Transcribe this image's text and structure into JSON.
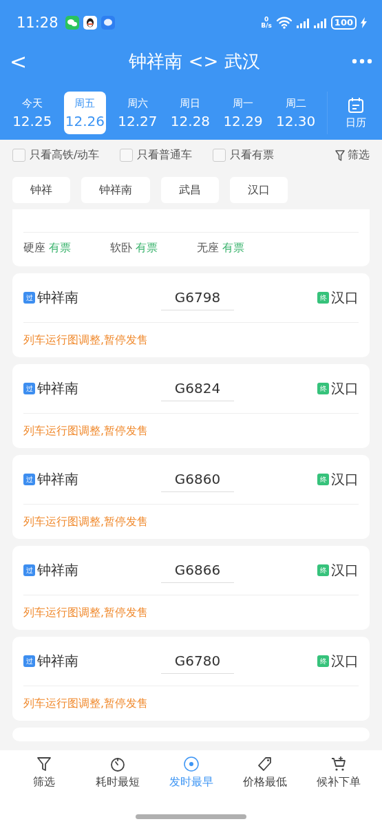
{
  "status_bar": {
    "time": "11:28",
    "net_speed_value": "0",
    "net_speed_unit": "B/s",
    "battery": "100"
  },
  "header": {
    "back": "<",
    "title": "钟祥南 <> 武汉"
  },
  "dates": [
    {
      "weekday": "今天",
      "date": "12.25",
      "selected": false
    },
    {
      "weekday": "周五",
      "date": "12.26",
      "selected": true
    },
    {
      "weekday": "周六",
      "date": "12.27",
      "selected": false
    },
    {
      "weekday": "周日",
      "date": "12.28",
      "selected": false
    },
    {
      "weekday": "周一",
      "date": "12.29",
      "selected": false
    },
    {
      "weekday": "周二",
      "date": "12.30",
      "selected": false
    }
  ],
  "calendar_label": "日历",
  "filters": [
    {
      "label": "只看高铁/动车",
      "checked": false
    },
    {
      "label": "只看普通车",
      "checked": false
    },
    {
      "label": "只看有票",
      "checked": false
    }
  ],
  "filter_button": "筛选",
  "stations": [
    "钟祥",
    "钟祥南",
    "武昌",
    "汉口"
  ],
  "partial_card": {
    "seats": [
      {
        "class": "硬座",
        "status": "有票"
      },
      {
        "class": "软卧",
        "status": "有票"
      },
      {
        "class": "无座",
        "status": "有票"
      }
    ]
  },
  "trains": [
    {
      "from_tag": "过",
      "from": "钟祥南",
      "number": "G6798",
      "to_tag": "终",
      "to": "汉口",
      "notice": "列车运行图调整,暂停发售"
    },
    {
      "from_tag": "过",
      "from": "钟祥南",
      "number": "G6824",
      "to_tag": "终",
      "to": "汉口",
      "notice": "列车运行图调整,暂停发售"
    },
    {
      "from_tag": "过",
      "from": "钟祥南",
      "number": "G6860",
      "to_tag": "终",
      "to": "汉口",
      "notice": "列车运行图调整,暂停发售"
    },
    {
      "from_tag": "过",
      "from": "钟祥南",
      "number": "G6866",
      "to_tag": "终",
      "to": "汉口",
      "notice": "列车运行图调整,暂停发售"
    },
    {
      "from_tag": "过",
      "from": "钟祥南",
      "number": "G6780",
      "to_tag": "终",
      "to": "汉口",
      "notice": "列车运行图调整,暂停发售"
    }
  ],
  "bottom_nav": [
    {
      "kind": "filter",
      "label": "筛选",
      "selected": false
    },
    {
      "kind": "duration",
      "label": "耗时最短",
      "selected": false
    },
    {
      "kind": "earliest",
      "label": "发时最早",
      "selected": true
    },
    {
      "kind": "price",
      "label": "价格最低",
      "selected": false
    },
    {
      "kind": "waitlist",
      "label": "候补下单",
      "selected": false
    }
  ]
}
